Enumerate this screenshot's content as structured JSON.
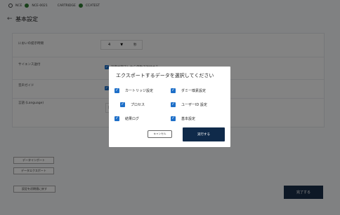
{
  "statusbar": {
    "items": [
      {
        "label": "NCE",
        "ok": true
      },
      {
        "label": "NCE-0021",
        "ok": false
      },
      {
        "label": "CARTRIDGE",
        "ok": true
      },
      {
        "label": "CCATEST",
        "ok": false
      }
    ],
    "colors": {
      "ok": "#2e7d32"
    }
  },
  "header": {
    "back_icon": "arrow-left-icon",
    "title": "基本設定"
  },
  "settings": {
    "rows": [
      {
        "label": "においの提示時間",
        "select_value": "4",
        "unit": "秒"
      },
      {
        "label": "サイエンス送付",
        "checkbox_text": "設定が完了したら自動で送付する"
      },
      {
        "label": "音声ガイド",
        "checkbox_text": "音声ガイドを使用する"
      },
      {
        "label": "言語 (Language)",
        "select_value": "日本語"
      }
    ]
  },
  "side_buttons": {
    "data_import": "データインポート",
    "data_export": "データエクスポート",
    "reset": "設定を初期値に戻す"
  },
  "done_button": "完了する",
  "modal": {
    "title": "エクスポートするデータを選択してください",
    "options": [
      {
        "label": "カートリッジ設定",
        "checked": true
      },
      {
        "label": "ダミー嗅素設定",
        "checked": true
      },
      {
        "label": "プロセス",
        "checked": true
      },
      {
        "label": "ユーザーID 設定",
        "checked": true
      },
      {
        "label": "結果ログ",
        "checked": true
      },
      {
        "label": "基本設定",
        "checked": true
      }
    ],
    "cancel_label": "キャンセル",
    "execute_label": "実行する",
    "colors": {
      "accent": "#1e6fc8",
      "primary": "#0f2a4a"
    }
  }
}
